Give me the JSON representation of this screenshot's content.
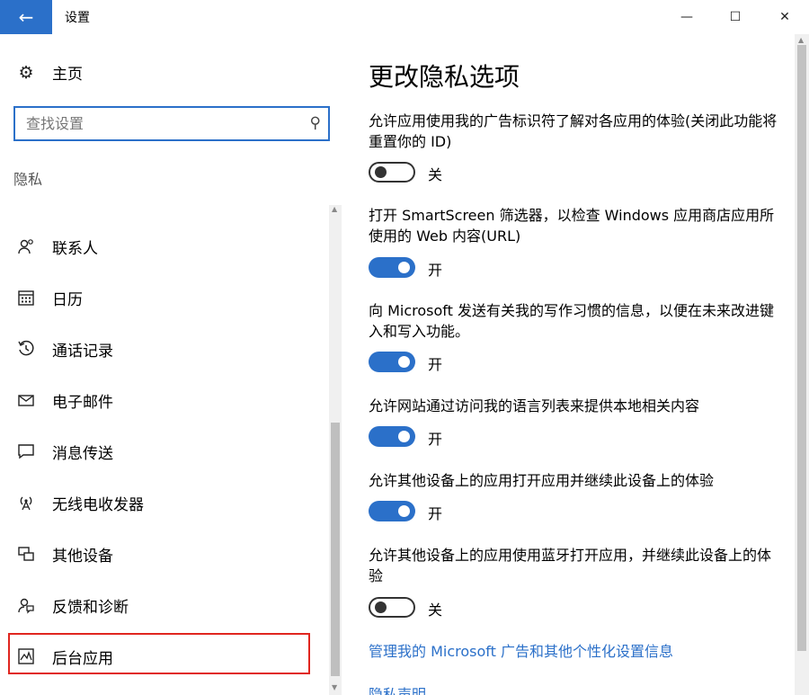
{
  "window": {
    "back_icon": "back-arrow-icon",
    "title": "设置",
    "min_label": "—",
    "max_label": "☐",
    "close_label": "✕"
  },
  "sidebar": {
    "home_label": "主页",
    "search_placeholder": "查找设置",
    "section": "隐私",
    "items": [
      {
        "label": "联系人",
        "icon": "contacts-icon"
      },
      {
        "label": "日历",
        "icon": "calendar-icon"
      },
      {
        "label": "通话记录",
        "icon": "call-history-icon"
      },
      {
        "label": "电子邮件",
        "icon": "email-icon"
      },
      {
        "label": "消息传送",
        "icon": "messaging-icon"
      },
      {
        "label": "无线电收发器",
        "icon": "radios-icon"
      },
      {
        "label": "其他设备",
        "icon": "other-devices-icon"
      },
      {
        "label": "反馈和诊断",
        "icon": "feedback-icon"
      },
      {
        "label": "后台应用",
        "icon": "background-apps-icon"
      }
    ],
    "selected": "后台应用"
  },
  "main": {
    "title": "更改隐私选项",
    "options": [
      {
        "text": "允许应用使用我的广告标识符了解对各应用的体验(关闭此功能将重置你的 ID)",
        "enabled": false,
        "state_label": "关"
      },
      {
        "text": "打开 SmartScreen 筛选器，以检查 Windows 应用商店应用所使用的 Web 内容(URL)",
        "enabled": true,
        "state_label": "开"
      },
      {
        "text": "向 Microsoft 发送有关我的写作习惯的信息，以便在未来改进键入和写入功能。",
        "enabled": true,
        "state_label": "开"
      },
      {
        "text": "允许网站通过访问我的语言列表来提供本地相关内容",
        "enabled": true,
        "state_label": "开"
      },
      {
        "text": "允许其他设备上的应用打开应用并继续此设备上的体验",
        "enabled": true,
        "state_label": "开"
      },
      {
        "text": "允许其他设备上的应用使用蓝牙打开应用，并继续此设备上的体验",
        "enabled": false,
        "state_label": "关"
      }
    ],
    "links": [
      "管理我的 Microsoft 广告和其他个性化设置信息",
      "隐私声明"
    ]
  },
  "colors": {
    "accent": "#2b70c9",
    "highlight_border": "#e0261f"
  }
}
